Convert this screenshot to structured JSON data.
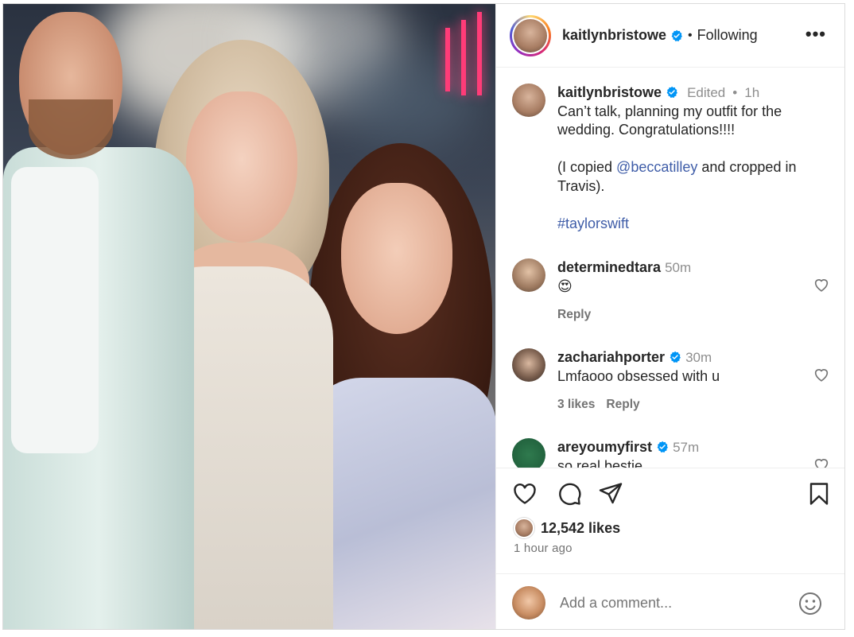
{
  "header": {
    "username": "kaitlynbristowe",
    "separator": "•",
    "follow_status": "Following",
    "more_label": "•••"
  },
  "caption": {
    "username": "kaitlynbristowe",
    "edited": "Edited",
    "dot": "•",
    "time": "1h",
    "line1": "Can’t talk, planning my outfit for the wedding. Congratulations!!!!",
    "line2_pre": "(I copied ",
    "mention": "@beccatilley",
    "line2_post": " and cropped in Travis).",
    "hashtag": "#taylorswift"
  },
  "comments": [
    {
      "username": "determinedtara",
      "time": "50m",
      "text": "😍",
      "likes": "",
      "reply": "Reply",
      "verified": false
    },
    {
      "username": "zachariahporter",
      "time": "30m",
      "text": "Lmfaooo obsessed with u",
      "likes": "3 likes",
      "reply": "Reply",
      "verified": true
    },
    {
      "username": "areyoumyfirst",
      "time": "57m",
      "text": "so real bestie",
      "verified": true
    }
  ],
  "engagement": {
    "likes": "12,542 likes",
    "posted": "1 hour ago"
  },
  "comment_box": {
    "placeholder": "Add a comment..."
  },
  "icons": {
    "like": "heart-icon",
    "comment": "comment-icon",
    "share": "paper-plane-icon",
    "save": "bookmark-icon",
    "emoji": "emoji-icon",
    "verified": "verified-badge-icon",
    "more": "more-options-icon"
  },
  "colors": {
    "verified": "#0095f6",
    "link": "#3f5da8",
    "muted": "#737373",
    "text": "#262626"
  }
}
